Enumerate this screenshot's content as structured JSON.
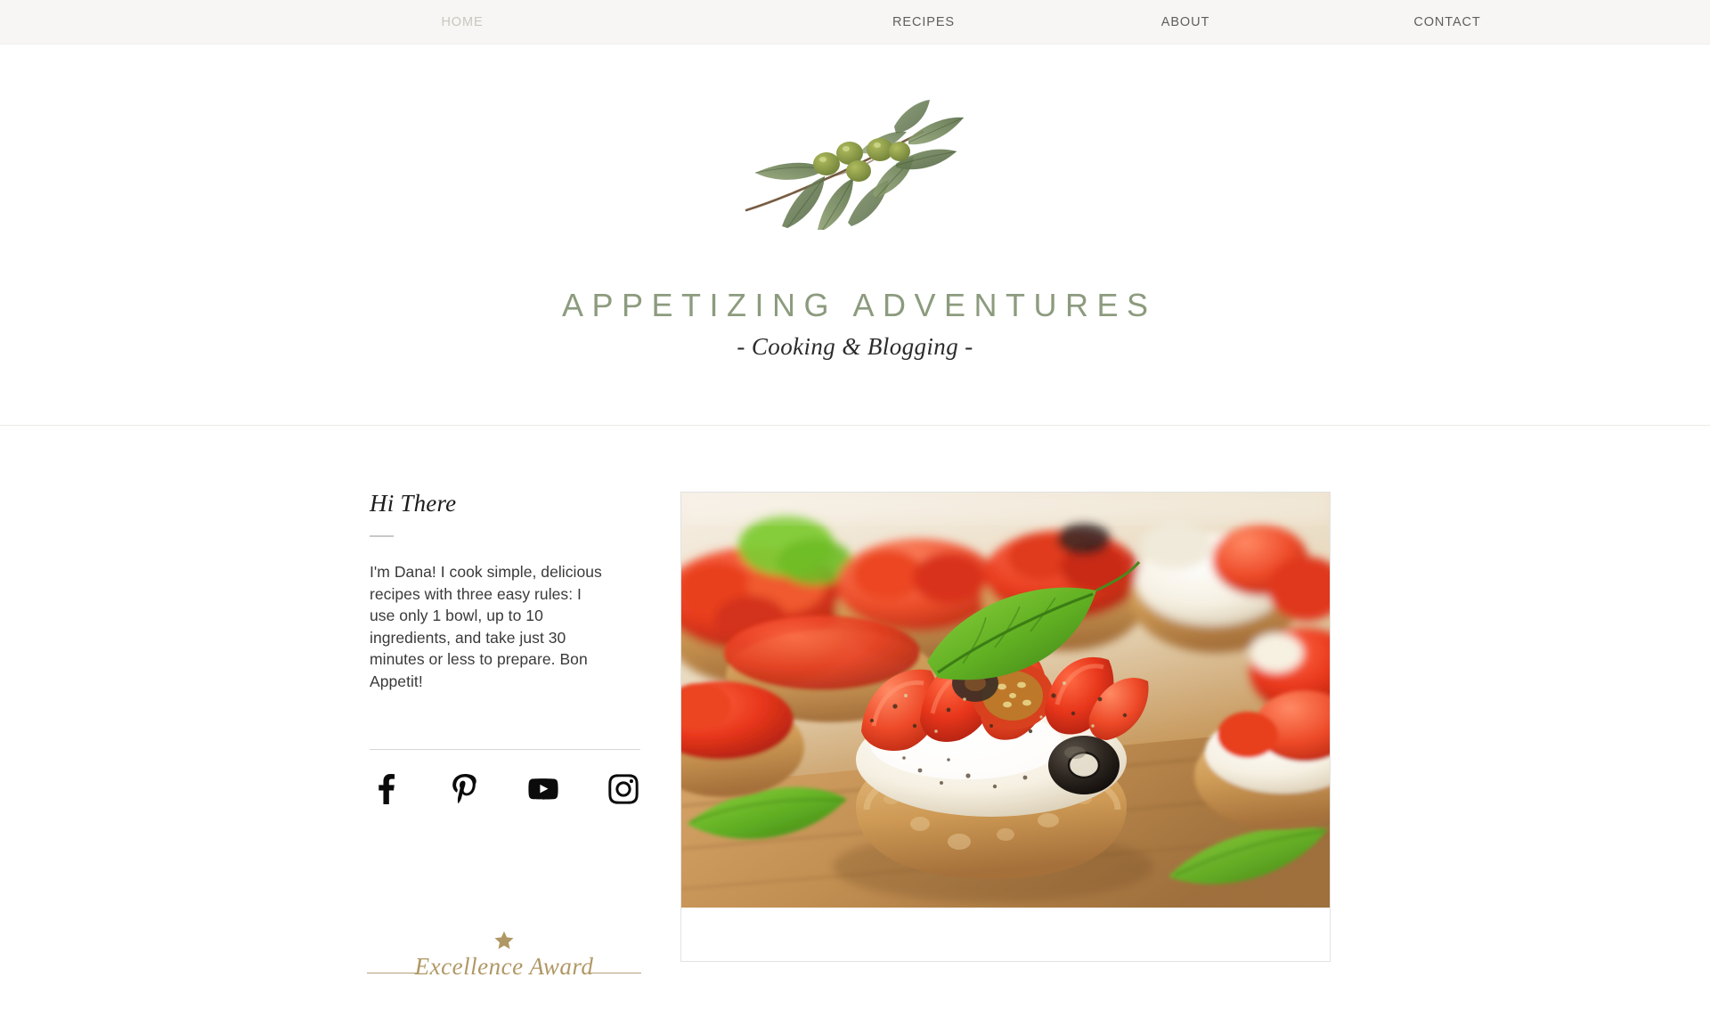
{
  "nav": {
    "items": [
      {
        "label": "HOME",
        "state": "active"
      },
      {
        "label": "RECIPES",
        "state": "default"
      },
      {
        "label": "ABOUT",
        "state": "default"
      },
      {
        "label": "CONTACT",
        "state": "default"
      }
    ]
  },
  "hero": {
    "logo_icon": "olive-branch-illustration",
    "title": "APPETIZING ADVENTURES",
    "tagline": "- Cooking & Blogging -"
  },
  "intro": {
    "heading": "Hi There",
    "body": "I'm Dana! I cook simple, delicious recipes with three easy rules: I use only 1 bowl, up to 10 ingredients, and take just 30 minutes or less to prepare. Bon Appetit!"
  },
  "social": {
    "links": [
      {
        "name": "facebook-icon",
        "label": "Facebook"
      },
      {
        "name": "pinterest-icon",
        "label": "Pinterest"
      },
      {
        "name": "youtube-icon",
        "label": "YouTube"
      },
      {
        "name": "instagram-icon",
        "label": "Instagram"
      }
    ]
  },
  "award": {
    "icon": "star-icon",
    "text": "Excellence Award"
  },
  "photo": {
    "alt": "Bruschetta appetizers with tomato, mozzarella, black olive and basil on a wooden board"
  },
  "colors": {
    "nav_bar_bg": "#F7F6F4",
    "nav_active": "#C9C6BE",
    "nav_default": "#5E5E5E",
    "title_green": "#8C9B7E",
    "award_gold": "#B09865",
    "body_text": "#3A3A3A",
    "page_bg": "#FFFFFF"
  }
}
